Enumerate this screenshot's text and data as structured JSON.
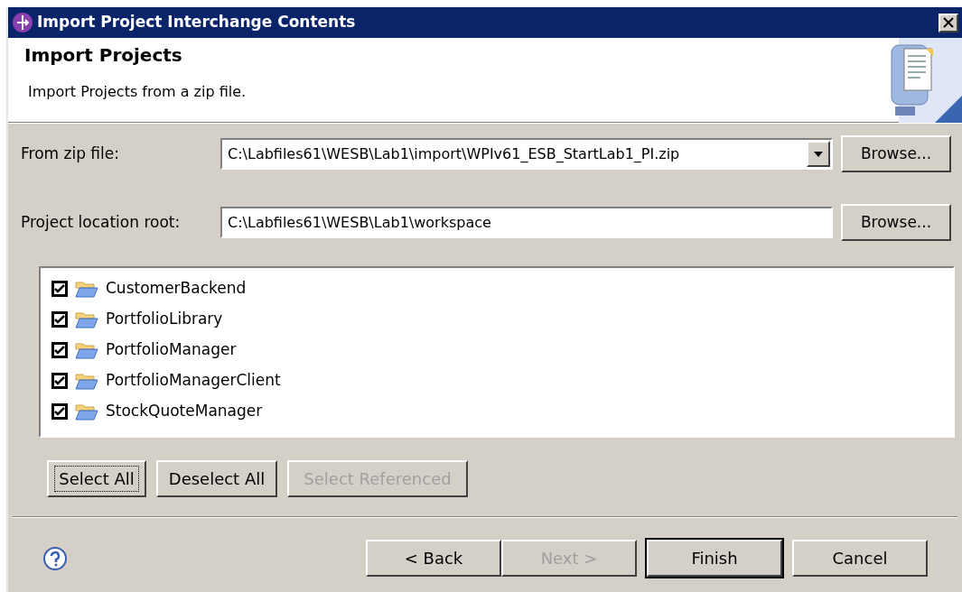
{
  "window": {
    "title": "Import Project Interchange Contents"
  },
  "header": {
    "title": "Import Projects",
    "description": "Import Projects from a zip file."
  },
  "fields": [
    {
      "label": "From zip file:",
      "value": "C:\\Labfiles61\\WESB\\Lab1\\import\\WPIv61_ESB_StartLab1_PI.zip",
      "kind": "combo",
      "button": "Browse..."
    },
    {
      "label": "Project location root:",
      "value": "C:\\Labfiles61\\WESB\\Lab1\\workspace",
      "kind": "text",
      "button": "Browse..."
    }
  ],
  "projects": [
    {
      "name": "CustomerBackend",
      "checked": true
    },
    {
      "name": "PortfolioLibrary",
      "checked": true
    },
    {
      "name": "PortfolioManager",
      "checked": true
    },
    {
      "name": "PortfolioManagerClient",
      "checked": true
    },
    {
      "name": "StockQuoteManager",
      "checked": true
    }
  ],
  "selection_buttons": [
    {
      "label": "Select All",
      "disabled": false,
      "focused": true
    },
    {
      "label": "Deselect All",
      "disabled": false,
      "focused": false
    },
    {
      "label": "Select Referenced",
      "disabled": true,
      "focused": false
    }
  ],
  "nav_buttons": [
    {
      "label": "< Back",
      "disabled": false,
      "default": false
    },
    {
      "label": "Next >",
      "disabled": true,
      "default": false
    },
    {
      "label": "Finish",
      "disabled": false,
      "default": true
    },
    {
      "label": "Cancel",
      "disabled": false,
      "default": false
    }
  ]
}
